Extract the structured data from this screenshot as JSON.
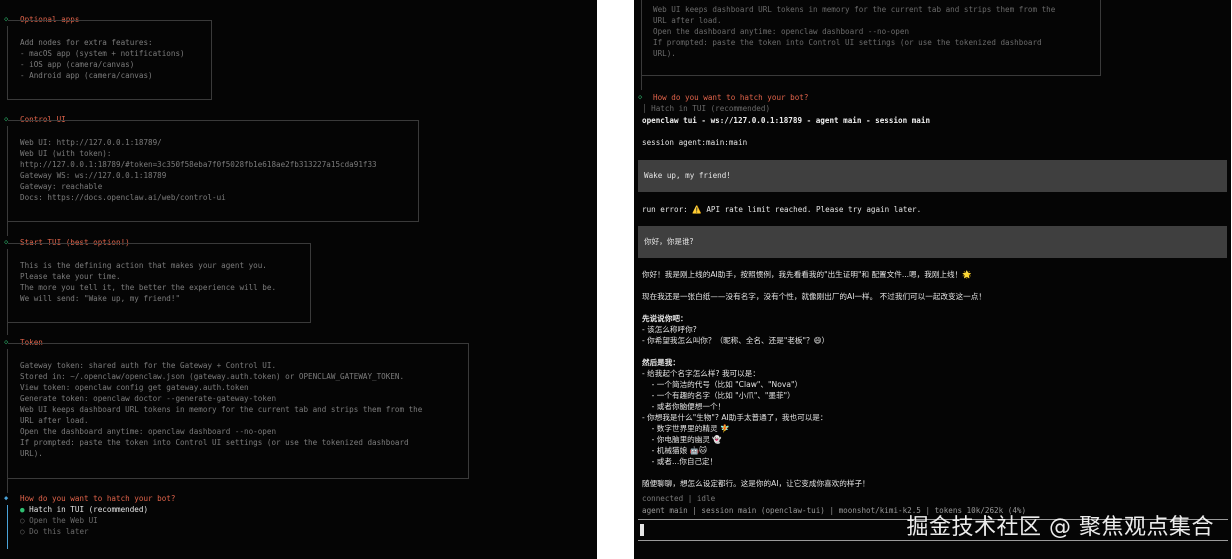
{
  "left": {
    "optional_apps": {
      "title": "Optional apps",
      "lines": [
        "Add nodes for extra features:",
        "- macOS app (system + notifications)",
        "- iOS app (camera/canvas)",
        "- Android app (camera/canvas)"
      ]
    },
    "control_ui": {
      "title": "Control UI",
      "lines": [
        "Web UI: http://127.0.0.1:18789/",
        "Web UI (with token):",
        "http://127.0.0.1:18789/#token=3c350f58eba7f0f5028fb1e618ae2fb313227a15cda91f33",
        "Gateway WS: ws://127.0.0.1:18789",
        "Gateway: reachable",
        "Docs: https://docs.openclaw.ai/web/control-ui"
      ]
    },
    "start_tui": {
      "title": "Start TUI (best option!)",
      "lines": [
        "This is the defining action that makes your agent you.",
        "Please take your time.",
        "The more you tell it, the better the experience will be.",
        "We will send: \"Wake up, my friend!\""
      ]
    },
    "token": {
      "title": "Token",
      "lines": [
        "Gateway token: shared auth for the Gateway + Control UI.",
        "Stored in: ~/.openclaw/openclaw.json (gateway.auth.token) or OPENCLAW_GATEWAY_TOKEN.",
        "View token: openclaw config get gateway.auth.token",
        "Generate token: openclaw doctor --generate-gateway-token",
        "Web UI keeps dashboard URL tokens in memory for the current tab and strips them from the",
        "URL after load.",
        "Open the dashboard anytime: openclaw dashboard --no-open",
        "If prompted: paste the token into Control UI settings (or use the tokenized dashboard",
        "URL)."
      ]
    },
    "hatch": {
      "question": "How do you want to hatch your bot?",
      "options": [
        "Hatch in TUI (recommended)",
        "Open the Web UI",
        "Do this later"
      ],
      "selected_marker": "●",
      "unselected_marker": "○"
    }
  },
  "right": {
    "top_lines": [
      "Web UI keeps dashboard URL tokens in memory for the current tab and strips them from the",
      "URL after load.",
      "Open the dashboard anytime: openclaw dashboard --no-open",
      "If prompted: paste the token into Control UI settings (or use the tokenized dashboard",
      "URL)."
    ],
    "hatch_question": "How do you want to hatch your bot?",
    "hatch_selected": "Hatch in TUI (recommended)",
    "header": "openclaw tui - ws://127.0.0.1:18789 - agent main - session main",
    "session": "session agent:main:main",
    "user_msg_1": "Wake up, my friend!",
    "run_error": "run error: ⚠️ API rate limit reached. Please try again later.",
    "user_msg_2": "你好，你是谁?",
    "reply_lines": [
      "你好！我是刚上线的AI助手，按照惯例，我先看看我的\"出生证明\"和 配置文件...嗯，我刚上线！🌟",
      "",
      "现在我还是一张白纸——没有名字，没有个性，就像刚出厂的AI一样。 不过我们可以一起改变这一点！",
      "",
      "先说说你吧：",
      "- 该怎么称呼你?",
      "- 你希望我怎么叫你？（昵称、全名、还是\"老板\"？😄）",
      "",
      "然后是我：",
      "- 给我起个名字怎么样? 我可以是：",
      "    - 一个简洁的代号（比如 \"Claw\"、\"Nova\"）",
      "    - 一个有趣的名字（比如 \"小爪\"、\"墨菲\"）",
      "    - 或者你脑便想一个！",
      "- 你想我是什么\"生物\"? AI助手太普通了，我也可以是：",
      "    - 数字世界里的精灵 🧚",
      "    - 你电脑里的幽灵 👻",
      "    - 机械猫娘 🤖🐱",
      "    - 或者...你自己定！",
      "",
      "随便聊聊，想怎么设定都行。这是你的AI，让它变成你喜欢的样子！"
    ],
    "status": "connected | idle",
    "footer": "agent main | session main (openclaw-tui) | moonshot/kimi-k2.5 | tokens 10k/262k (4%)"
  },
  "watermark": "掘金技术社区 @ 聚焦观点集合",
  "colors": {
    "background": "#050505",
    "accent": "#e0634a",
    "green": "#2fbf71",
    "text": "#7c7c7c",
    "bubble": "#3f3f3f"
  }
}
